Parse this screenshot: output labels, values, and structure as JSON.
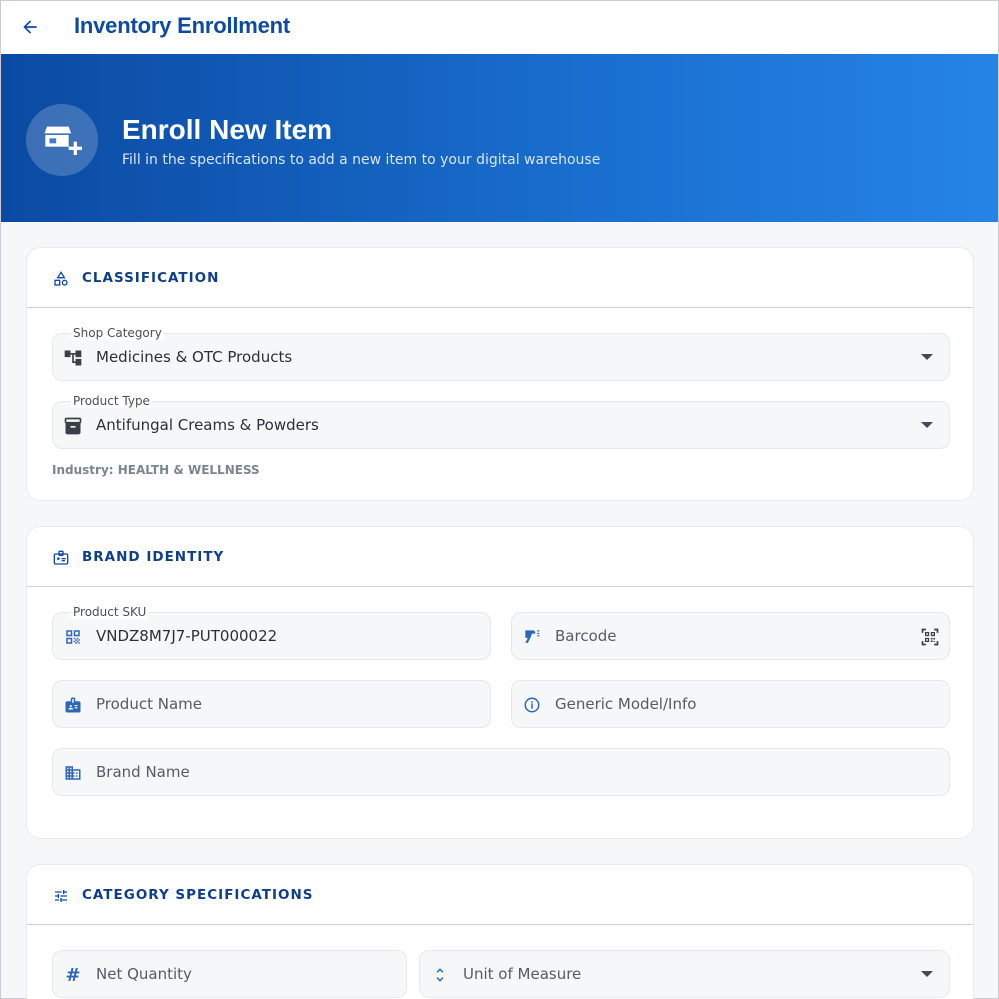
{
  "appbar": {
    "title": "Inventory Enrollment",
    "back_icon": "arrow-back-icon"
  },
  "hero": {
    "title": "Enroll New Item",
    "subtitle": "Fill in the specifications to add a new item to your digital warehouse",
    "icon": "add-business-icon"
  },
  "classification": {
    "title": "CLASSIFICATION",
    "icon": "category-shapes-icon",
    "shop_category": {
      "label": "Shop Category",
      "value": "Medicines & OTC Products",
      "icon": "account-tree-icon"
    },
    "product_type": {
      "label": "Product Type",
      "value": "Antifungal Creams & Powders",
      "icon": "inventory-box-icon"
    },
    "industry_note": "Industry: HEALTH & WELLNESS"
  },
  "brand_identity": {
    "title": "BRAND IDENTITY",
    "icon": "badge-icon",
    "sku": {
      "label": "Product SKU",
      "value": "VNDZ8M7J7-PUT000022",
      "icon": "qr-code-icon"
    },
    "barcode": {
      "placeholder": "Barcode",
      "icon": "barcode-scanner-icon",
      "trailing_icon": "qr-scan-icon"
    },
    "product_name": {
      "placeholder": "Product Name",
      "icon": "badge-icon"
    },
    "generic_model": {
      "placeholder": "Generic Model/Info",
      "icon": "info-icon"
    },
    "brand_name": {
      "placeholder": "Brand Name",
      "icon": "business-icon"
    }
  },
  "category_specs": {
    "title": "CATEGORY SPECIFICATIONS",
    "icon": "tune-icon",
    "net_quantity": {
      "placeholder": "Net Quantity",
      "icon": "tag-icon"
    },
    "unit_of_measure": {
      "placeholder": "Unit of Measure",
      "icon": "unfold-more-icon"
    }
  },
  "colors": {
    "primary": "#0e4aa0",
    "accent": "#1a6fd0",
    "field_bg": "#f6f7f9"
  }
}
